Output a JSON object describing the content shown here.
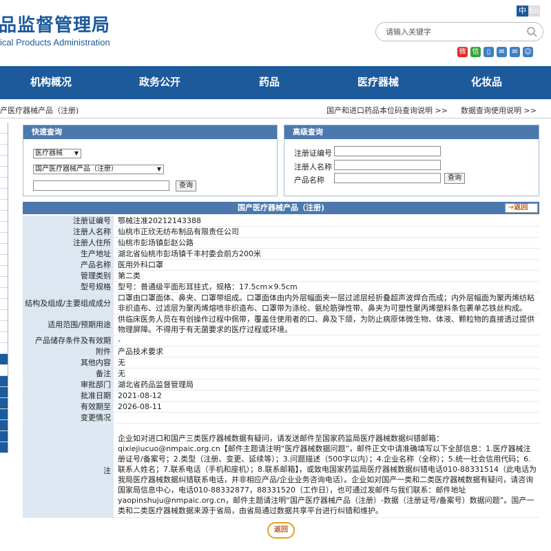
{
  "header": {
    "logo_cn": "药品监督管理局",
    "logo_cn_visible": "品监督管理局",
    "logo_en": "ical Products Administration",
    "lang_cn": "中",
    "lang_en": "En",
    "search_placeholder": "请输入关键字",
    "socials": [
      "weibo-icon",
      "wechat-icon",
      "mobile-icon",
      "mail-icon",
      "message-icon",
      "user-icon"
    ]
  },
  "nav": {
    "items": [
      "机构概况",
      "政务公开",
      "药品",
      "医疗器械",
      "化妆品"
    ]
  },
  "crumb": {
    "text": "产医疗器械产品（注册)",
    "help1": "国产和进口药品本位码查询说明 >>",
    "help2": "数据查询使用说明 >>"
  },
  "quick": {
    "title": "快速查询",
    "category": "医疗器械",
    "subcategory": "国产医疗器械产品（注册）",
    "search_button": "查询"
  },
  "advanced": {
    "title": "高级查询",
    "field1_label": "注册证编号",
    "field2_label": "注册人名称",
    "field3_label": "产品名称",
    "search_button": "查询"
  },
  "result": {
    "title": "国产医疗器械产品（注册)",
    "back_label": "返回",
    "rows": [
      {
        "label": "注册证编号",
        "value": "鄂械注准20212143388"
      },
      {
        "label": "注册人名称",
        "value": "仙桃市正欣无纺布制品有限责任公司"
      },
      {
        "label": "注册人住所",
        "value": "仙桃市彭场镇彭赵公路"
      },
      {
        "label": "生产地址",
        "value": "湖北省仙桃市彭场镇千丰村委会前方200米"
      },
      {
        "label": "产品名称",
        "value": "医用外科口罩"
      },
      {
        "label": "管理类别",
        "value": "第二类"
      },
      {
        "label": "型号规格",
        "value": "型号：普通级平面形耳挂式，规格：17.5cm×9.5cm"
      },
      {
        "label": "结构及组成/主要组成成分",
        "value": "口罩由口罩面体、鼻夹、口罩带组成。口罩面体由内外层幅面夹一层过滤层经折叠超声波焊合而成；内外层幅面为聚丙烯纺粘非织造布、过滤层为聚丙烯熔喷非织造布、口罩带为涤纶、氨纶筋弹性带、鼻夹为可塑性聚丙烯塑料条包裹单芯铁丝构成。"
      },
      {
        "label": "适用范围/预期用途",
        "value": "供临床医务人员在有创操作过程中佩带，覆盖住使用者的口、鼻及下颌，为防止病原体微生物、体液、颗粒物的直接透过提供物理屏障。不得用于有无菌要求的医疗过程或环境。"
      },
      {
        "label": "产品储存条件及有效期",
        "value": "-"
      },
      {
        "label": "附件",
        "value": "产品技术要求"
      },
      {
        "label": "其他内容",
        "value": "无"
      },
      {
        "label": "备注",
        "value": "无"
      },
      {
        "label": "审批部门",
        "value": "湖北省药品监督管理局"
      },
      {
        "label": "批准日期",
        "value": "2021-08-12"
      },
      {
        "label": "有效期至",
        "value": "2026-08-11"
      },
      {
        "label": "变更情况",
        "value": ""
      },
      {
        "label": "注",
        "value": "企业如对进口和国产三类医疗器械数据有疑问，请发送邮件至国家药监局医疗器械数据纠错邮箱：qixiejiucuo@nmpaic.org.cn【邮件主题请注明“医疗器械数据问题”，邮件正文中请准确填写以下全部信息：1.医疗器械注册证号/备案号；2.类型（注册、变更、延续等）；3.问题描述（500字以内）；4.企业名称（全称）；5.统一社会信用代码；6.联系人姓名；7.联系电话（手机和座机）；8.联系邮箱】，或致电国家药监局医疗器械数据纠错电话010-88331514（此电话为我局医疗器械数据纠错联系电话，并非相应产品/企业业务咨询电话）。企业如对国产一类和二类医疗器械数据有疑问，请咨询国家局信息中心，电话010-88332877，88331520（工作日），也可通过发邮件与我们联系：邮件地址yaopinshuju@nmpaic.org.cn，邮件主题请注明“国产医疗器械产品（注册）-数据（注册证号/备案号）数据问题”。国产一类和二类医疗器械数据来源于省局，由省局通过数据共享平台进行纠错和维护。"
      }
    ],
    "bottom_back": "返回"
  },
  "colors": {
    "brand": "#1c5a9c",
    "panel_header": "#4b79ae",
    "label_bg": "#dde7f1"
  }
}
